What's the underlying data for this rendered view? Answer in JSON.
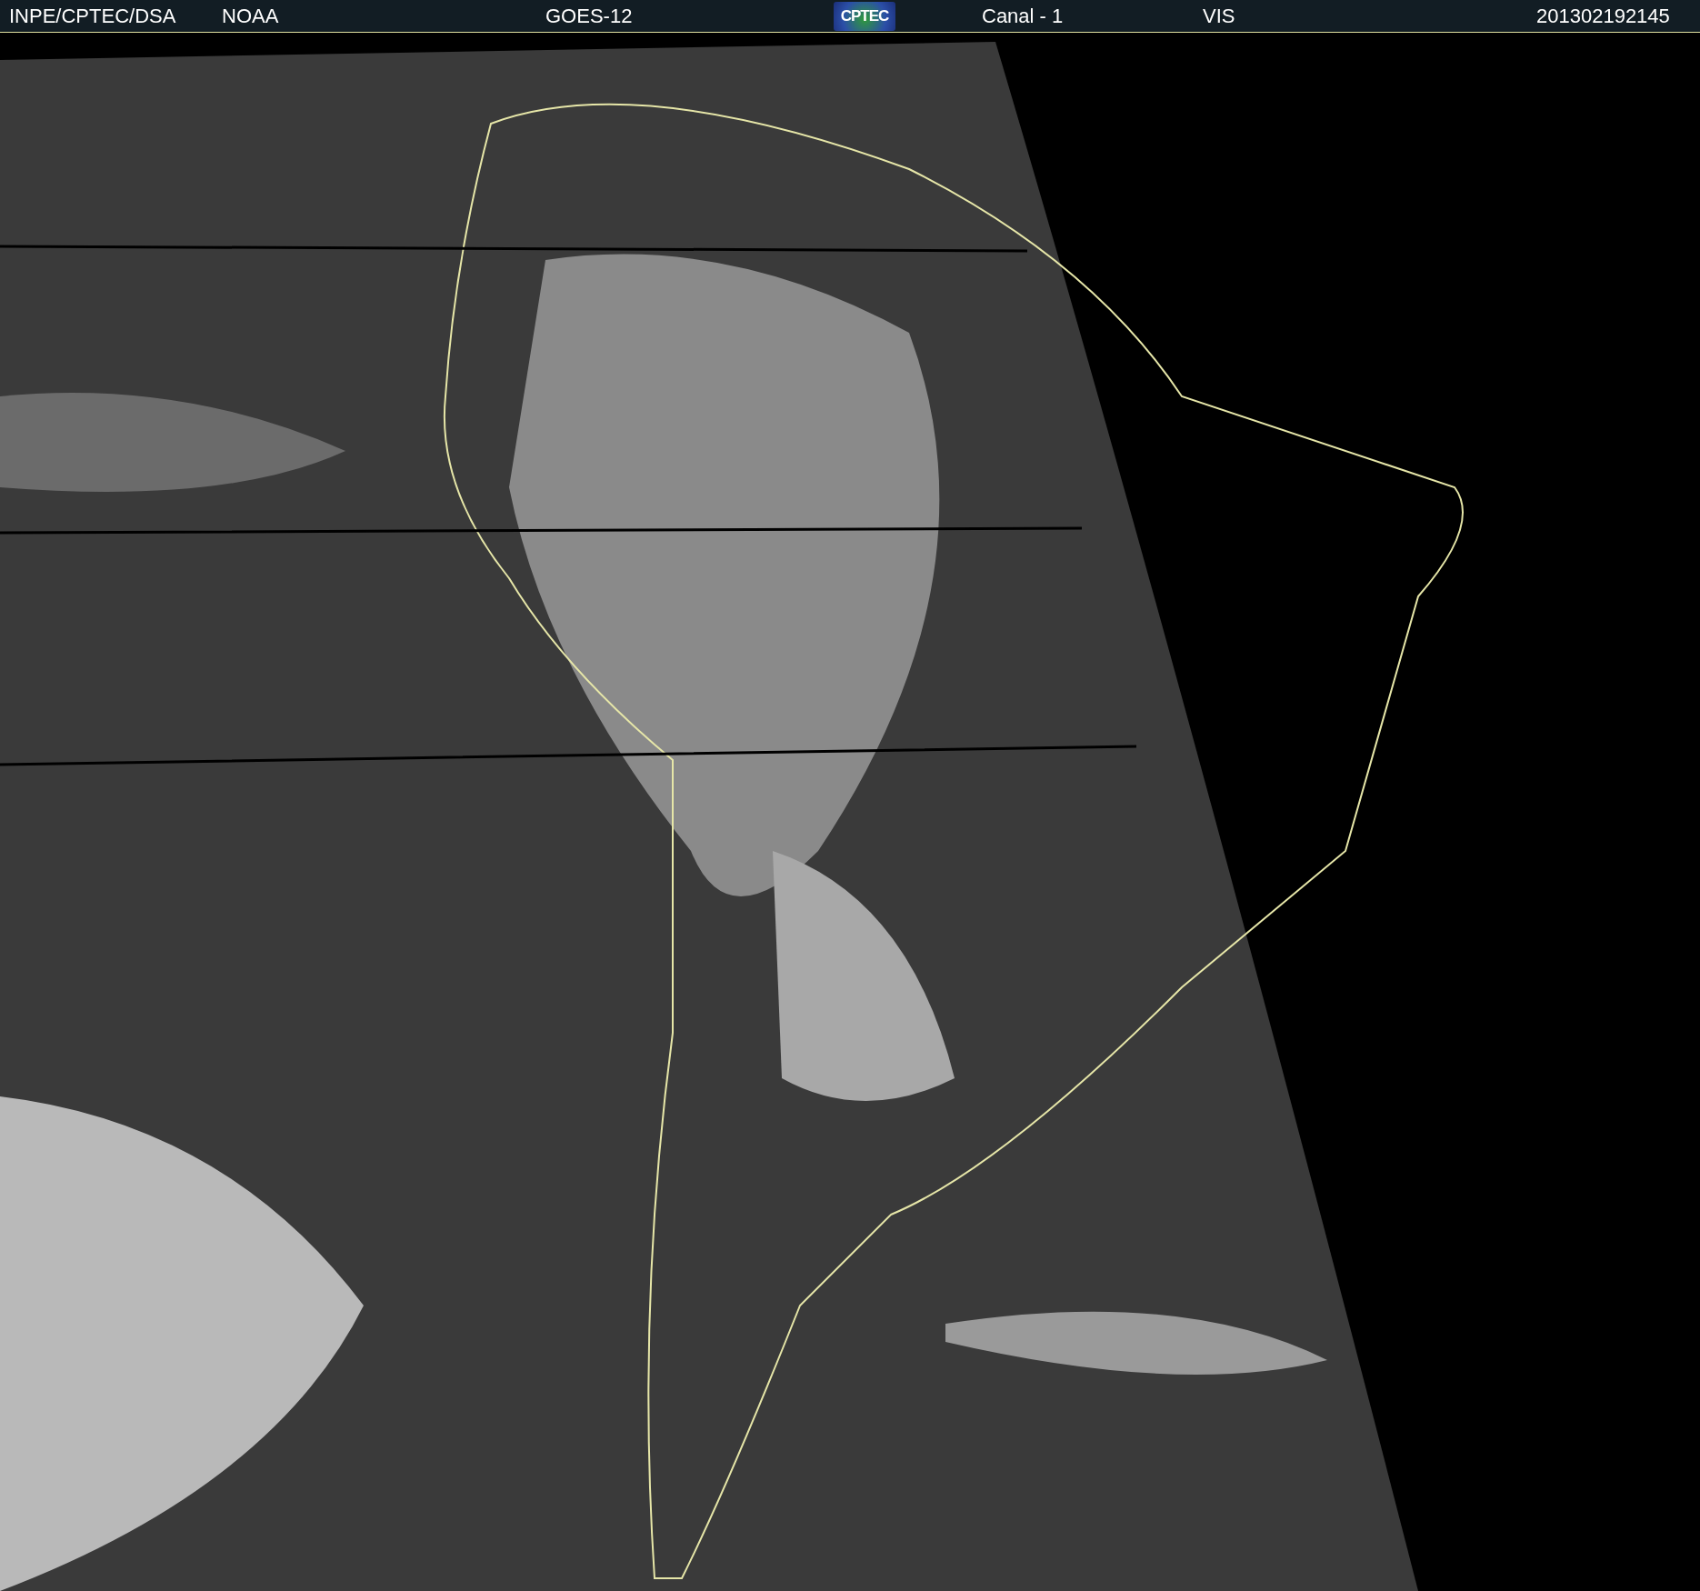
{
  "header": {
    "source": "INPE/CPTEC/DSA",
    "agency": "NOAA",
    "satellite": "GOES-12",
    "logo": "CPTEC",
    "channel": "Canal - 1",
    "band": "VIS",
    "timestamp": "201302192145"
  }
}
